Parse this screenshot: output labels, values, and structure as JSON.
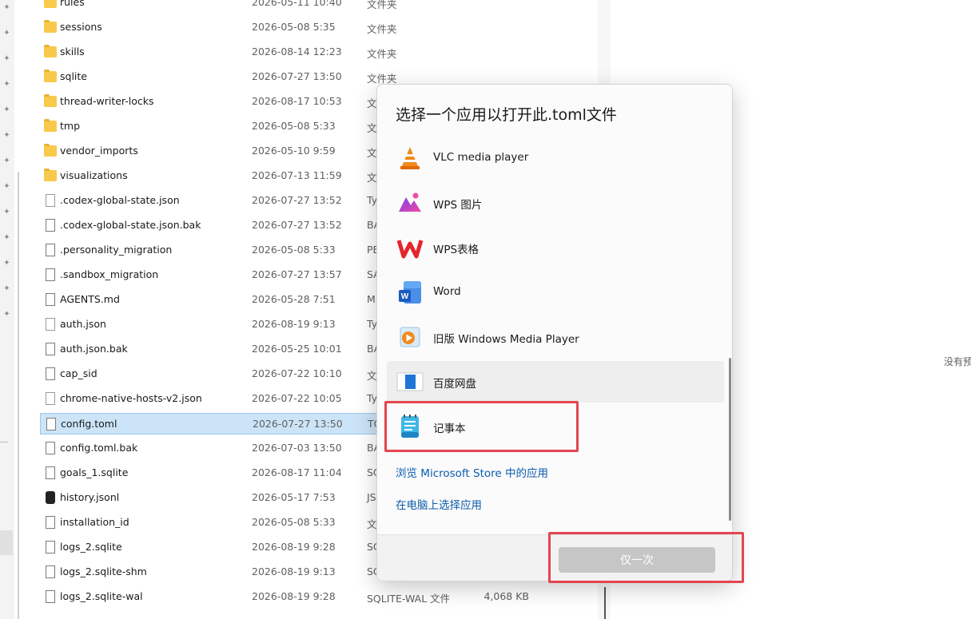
{
  "file_list": {
    "rows": [
      {
        "name": "rules",
        "date": "2026-05-11 10:40",
        "type": "文件夹",
        "size": "",
        "kind": "folder"
      },
      {
        "name": "sessions",
        "date": "2026-05-08 5:35",
        "type": "文件夹",
        "size": "",
        "kind": "folder"
      },
      {
        "name": "skills",
        "date": "2026-08-14 12:23",
        "type": "文件夹",
        "size": "",
        "kind": "folder"
      },
      {
        "name": "sqlite",
        "date": "2026-07-27 13:50",
        "type": "文件夹",
        "size": "",
        "kind": "folder"
      },
      {
        "name": "thread-writer-locks",
        "date": "2026-08-17 10:53",
        "type": "文",
        "size": "",
        "kind": "folder"
      },
      {
        "name": "tmp",
        "date": "2026-05-08 5:33",
        "type": "文",
        "size": "",
        "kind": "folder"
      },
      {
        "name": "vendor_imports",
        "date": "2026-05-10 9:59",
        "type": "文",
        "size": "",
        "kind": "folder"
      },
      {
        "name": "visualizations",
        "date": "2026-07-13 11:59",
        "type": "文",
        "size": "",
        "kind": "folder"
      },
      {
        "name": ".codex-global-state.json",
        "date": "2026-07-27 13:52",
        "type": "Ty",
        "size": "",
        "kind": "json"
      },
      {
        "name": ".codex-global-state.json.bak",
        "date": "2026-07-27 13:52",
        "type": "BA",
        "size": "",
        "kind": "file"
      },
      {
        "name": ".personality_migration",
        "date": "2026-05-08 5:33",
        "type": "PE",
        "size": "",
        "kind": "file"
      },
      {
        "name": ".sandbox_migration",
        "date": "2026-07-27 13:57",
        "type": "SA",
        "size": "",
        "kind": "file"
      },
      {
        "name": "AGENTS.md",
        "date": "2026-05-28 7:51",
        "type": "M",
        "size": "",
        "kind": "file"
      },
      {
        "name": "auth.json",
        "date": "2026-08-19 9:13",
        "type": "Ty",
        "size": "",
        "kind": "json"
      },
      {
        "name": "auth.json.bak",
        "date": "2026-05-25 10:01",
        "type": "BA",
        "size": "",
        "kind": "file"
      },
      {
        "name": "cap_sid",
        "date": "2026-07-22 10:10",
        "type": "文",
        "size": "",
        "kind": "file"
      },
      {
        "name": "chrome-native-hosts-v2.json",
        "date": "2026-07-22 10:05",
        "type": "Ty",
        "size": "",
        "kind": "json"
      },
      {
        "name": "config.toml",
        "date": "2026-07-27 13:50",
        "type": "TO",
        "size": "",
        "kind": "file",
        "selected": true
      },
      {
        "name": "config.toml.bak",
        "date": "2026-07-03 13:50",
        "type": "BA",
        "size": "",
        "kind": "file"
      },
      {
        "name": "goals_1.sqlite",
        "date": "2026-08-17 11:04",
        "type": "SQ",
        "size": "",
        "kind": "file"
      },
      {
        "name": "history.jsonl",
        "date": "2026-05-17 7:53",
        "type": "JS",
        "size": "",
        "kind": "dark"
      },
      {
        "name": "installation_id",
        "date": "2026-05-08 5:33",
        "type": "文",
        "size": "",
        "kind": "file"
      },
      {
        "name": "logs_2.sqlite",
        "date": "2026-08-19 9:28",
        "type": "SQ",
        "size": "",
        "kind": "file"
      },
      {
        "name": "logs_2.sqlite-shm",
        "date": "2026-08-19 9:13",
        "type": "SQ",
        "size": "",
        "kind": "file"
      },
      {
        "name": "logs_2.sqlite-wal",
        "date": "2026-08-19 9:28",
        "type": "SQLITE-WAL 文件",
        "size": "4,068 KB",
        "kind": "file"
      }
    ]
  },
  "preview": {
    "text": "没有预"
  },
  "dialog": {
    "title": "选择一个应用以打开此.toml文件",
    "apps": [
      {
        "label": "VLC media player",
        "icon": "vlc-icon"
      },
      {
        "label": "WPS 图片",
        "icon": "wps-picture-icon"
      },
      {
        "label": "WPS表格",
        "icon": "wps-sheet-icon"
      },
      {
        "label": "Word",
        "icon": "word-icon"
      },
      {
        "label": "旧版 Windows Media Player",
        "icon": "windows-media-player-icon"
      },
      {
        "label": "百度网盘",
        "icon": "baidu-netdisk-icon"
      },
      {
        "label": "记事本",
        "icon": "notepad-icon"
      }
    ],
    "store_link": "浏览 Microsoft Store 中的应用",
    "pc_link": "在电脑上选择应用",
    "once_button": "仅一次"
  },
  "colors": {
    "highlight": "#e5454f",
    "link": "#0b5cad",
    "selected_row": "#cce4f7"
  }
}
